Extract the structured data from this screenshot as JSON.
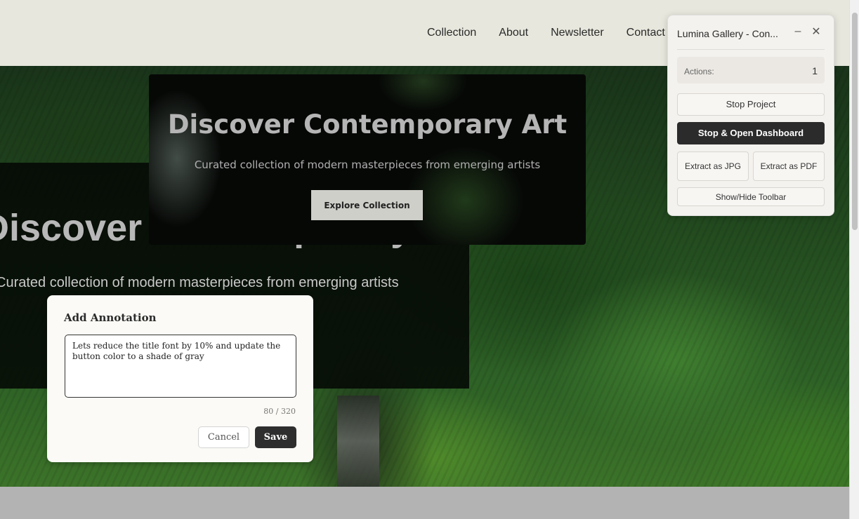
{
  "nav": {
    "items": [
      {
        "label": "Collection"
      },
      {
        "label": "About"
      },
      {
        "label": "Newsletter"
      },
      {
        "label": "Contact"
      }
    ]
  },
  "hero": {
    "title": "Discover Contemporary Art",
    "subtitle": "Curated collection of modern masterpieces from emerging artists"
  },
  "preview_card": {
    "title": "Discover Contemporary Art",
    "subtitle": "Curated collection of modern masterpieces from emerging artists",
    "cta_label": "Explore Collection"
  },
  "annotation": {
    "title": "Add Annotation",
    "text": "Lets reduce the title font by 10% and update the button color to a shade of gray",
    "count": "80 / 320",
    "cancel_label": "Cancel",
    "save_label": "Save"
  },
  "toolbar": {
    "title": "Lumina Gallery - Con...",
    "minimize_glyph": "–",
    "close_glyph": "✕",
    "actions_label": "Actions:",
    "actions_value": "1",
    "stop_label": "Stop Project",
    "dashboard_label": "Stop & Open Dashboard",
    "jpg_label": "Extract as JPG",
    "pdf_label": "Extract as PDF",
    "toggle_label": "Show/Hide Toolbar",
    "icons": [
      "minimize-icon",
      "close-icon"
    ]
  },
  "colors": {
    "header_bg": "#e7e7dd",
    "primary_dark": "#2b2b2b",
    "panel_bg": "#f4f2ee"
  }
}
